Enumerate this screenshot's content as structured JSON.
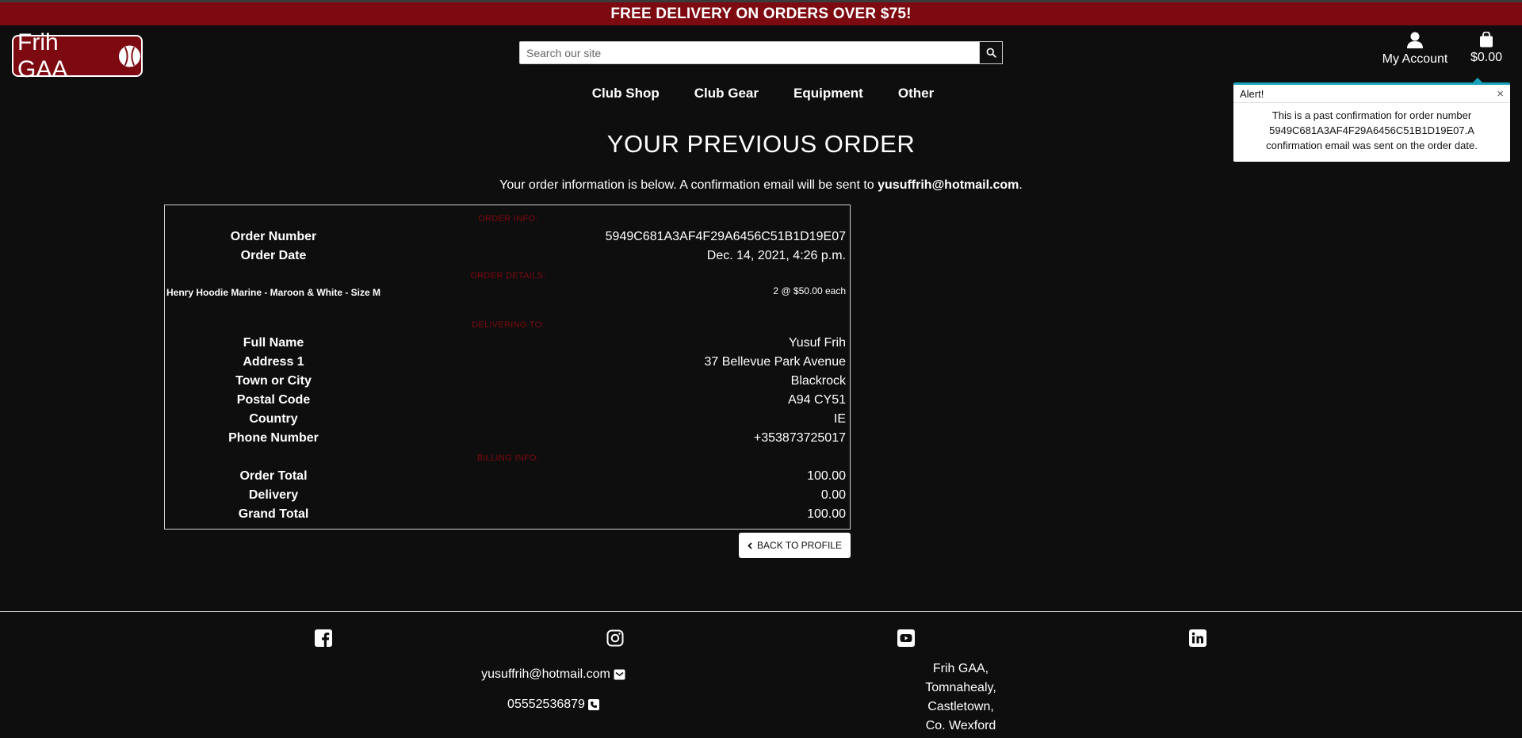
{
  "banner": {
    "text": "FREE DELIVERY ON ORDERS OVER $75!"
  },
  "header": {
    "logo_text": "Frih GAA",
    "search_placeholder": "Search our site",
    "account_label": "My Account",
    "bag_total": "$0.00"
  },
  "nav": {
    "items": [
      {
        "label": "Club Shop"
      },
      {
        "label": "Club Gear"
      },
      {
        "label": "Equipment"
      },
      {
        "label": "Other"
      }
    ]
  },
  "alert": {
    "title": "Alert!",
    "close": "×",
    "message": "This is a past confirmation for order number 5949C681A3AF4F29A6456C51B1D19E07.A confirmation email was sent on the order date."
  },
  "page": {
    "title": "YOUR PREVIOUS ORDER",
    "subtitle_prefix": "Your order information is below. A confirmation email will be sent to ",
    "subtitle_email": "yusuffrih@hotmail.com",
    "subtitle_suffix": "."
  },
  "order": {
    "sections": {
      "info": "ORDER INFO:",
      "details": "ORDER DETAILS:",
      "delivering": "DELIVERING TO:",
      "billing": "BILLING INFO:"
    },
    "order_number_label": "Order Number",
    "order_number": "5949C681A3AF4F29A6456C51B1D19E07",
    "order_date_label": "Order Date",
    "order_date": "Dec. 14, 2021, 4:26 p.m.",
    "item_name": "Henry Hoodie Marine - Maroon & White - Size M",
    "item_qty": "2 @ $50.00 each",
    "full_name_label": "Full Name",
    "full_name": "Yusuf Frih",
    "address1_label": "Address 1",
    "address1": "37 Bellevue Park Avenue",
    "town_label": "Town or City",
    "town": "Blackrock",
    "postal_label": "Postal Code",
    "postal": "A94 CY51",
    "country_label": "Country",
    "country": "IE",
    "phone_label": "Phone Number",
    "phone": "+353873725017",
    "order_total_label": "Order Total",
    "order_total": "100.00",
    "delivery_label": "Delivery",
    "delivery": "0.00",
    "grand_total_label": "Grand Total",
    "grand_total": "100.00",
    "back_label": "BACK TO PROFILE"
  },
  "footer": {
    "email": "yusuffrih@hotmail.com",
    "phone": "05552536879",
    "address_lines": [
      "Frih GAA,",
      "Tomnahealy,",
      "Castletown,",
      "Co. Wexford"
    ],
    "icons": [
      "facebook-icon",
      "instagram-icon",
      "youtube-icon",
      "linkedin-icon"
    ]
  },
  "colors": {
    "brand": "#7d0a10",
    "background": "#0e0e0e",
    "alert_accent": "#17a2b8"
  }
}
